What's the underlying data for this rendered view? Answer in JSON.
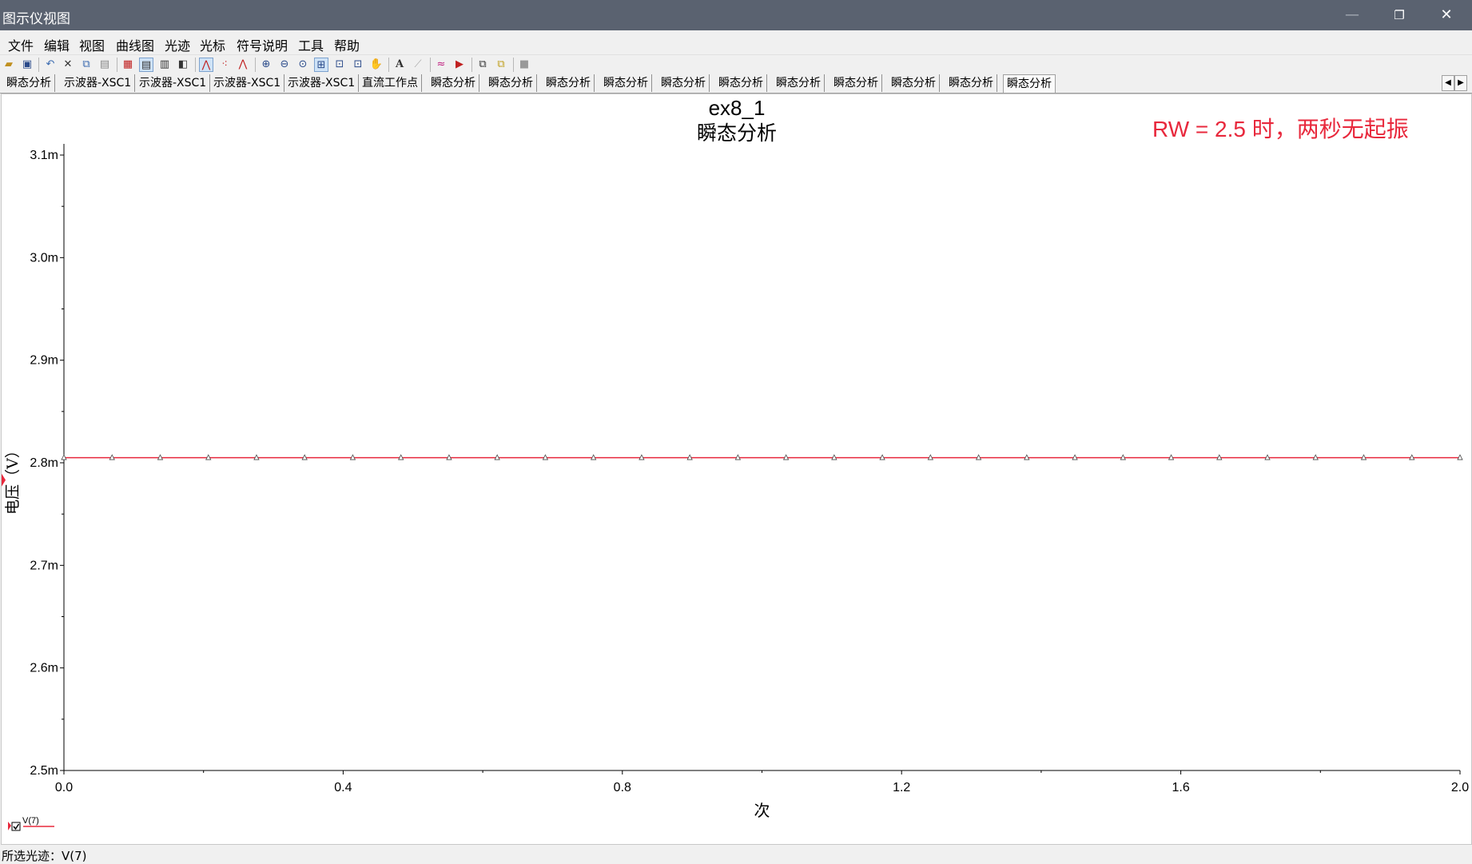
{
  "window": {
    "title": "图示仪视图",
    "minimize": "—",
    "restore": "❐",
    "close": "✕"
  },
  "menu": [
    "文件",
    "编辑",
    "视图",
    "曲线图",
    "光迹",
    "光标",
    "符号说明",
    "工具",
    "帮助"
  ],
  "toolbar_icons": [
    "open-icon",
    "save-icon",
    "undo-icon",
    "cut-icon",
    "copy-icon",
    "paste-icon",
    "grid-icon",
    "legend-icon",
    "selected-mark-icon",
    "reverse-colors-icon",
    "show-lines-icon",
    "show-points-icon",
    "show-lines-points-icon",
    "zoom-in-icon",
    "zoom-out-icon",
    "zoom-fit-icon",
    "zoom-area-icon",
    "zoom-x-icon",
    "zoom-y-icon",
    "pan-icon",
    "text-label-icon",
    "line-label-icon",
    "overlay-traces-icon",
    "export-icon",
    "copy-graph-icon",
    "paste-graph-icon",
    "stop-icon"
  ],
  "tabs": [
    "瞬态分析",
    "示波器-XSC1",
    "示波器-XSC1",
    "示波器-XSC1",
    "示波器-XSC1",
    "直流工作点",
    "瞬态分析",
    "瞬态分析",
    "瞬态分析",
    "瞬态分析",
    "瞬态分析",
    "瞬态分析",
    "瞬态分析",
    "瞬态分析",
    "瞬态分析",
    "瞬态分析",
    "瞬态分析"
  ],
  "active_tab_index": 16,
  "annotation": {
    "text": "RW = 2.5 时，两秒无起振",
    "color": "#e8283c"
  },
  "legend": {
    "label": "V(7)",
    "checked": true
  },
  "status": {
    "text": "所选光迹：V(7)"
  },
  "chart_data": {
    "type": "line",
    "title": "ex8_1",
    "subtitle": "瞬态分析",
    "xlabel": "次",
    "ylabel": "电压（V）",
    "xlim": [
      0.0,
      2.0
    ],
    "ylim": [
      0.0025,
      0.0031
    ],
    "x_ticks": [
      {
        "value": 0.0,
        "label": "0.0"
      },
      {
        "value": 0.4,
        "label": "0.4"
      },
      {
        "value": 0.8,
        "label": "0.8"
      },
      {
        "value": 1.2,
        "label": "1.2"
      },
      {
        "value": 1.6,
        "label": "1.6"
      },
      {
        "value": 2.0,
        "label": "2.0"
      }
    ],
    "y_ticks": [
      {
        "value": 0.0025,
        "label": "2.5m"
      },
      {
        "value": 0.0026,
        "label": "2.6m"
      },
      {
        "value": 0.0027,
        "label": "2.7m"
      },
      {
        "value": 0.0028,
        "label": "2.8m"
      },
      {
        "value": 0.0029,
        "label": "2.9m"
      },
      {
        "value": 0.003,
        "label": "3.0m"
      },
      {
        "value": 0.0031,
        "label": "3.1m"
      }
    ],
    "grid": false,
    "series": [
      {
        "name": "V(7)",
        "color": "#e8283c",
        "marker": "triangle",
        "x_start": 0.0,
        "x_end": 2.0,
        "marker_count": 30,
        "value": 0.002805
      }
    ]
  }
}
